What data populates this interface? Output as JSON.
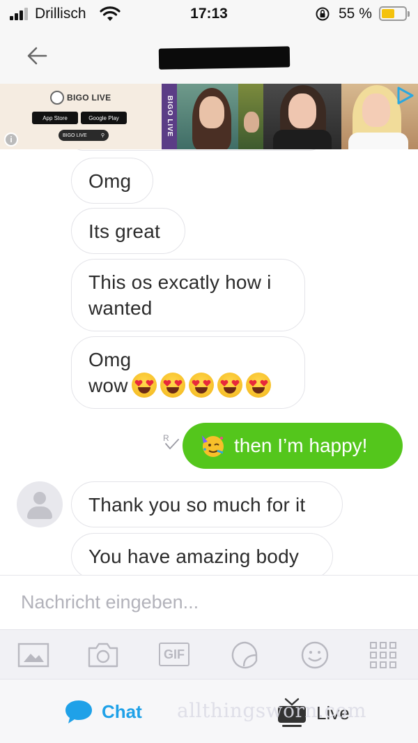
{
  "status_bar": {
    "carrier": "Drillisch",
    "time": "17:13",
    "battery_percent": "55 %",
    "battery_level": 0.55,
    "icons": [
      "signal-icon",
      "wifi-icon",
      "rotation-lock-icon",
      "battery-icon"
    ]
  },
  "header": {
    "back_icon": "arrow-left-icon",
    "contact_name_redacted": true
  },
  "ad": {
    "brand": "BIGO LIVE",
    "vertical_label": "BIGO LIVE",
    "store_badges": [
      "App Store",
      "Google Play"
    ],
    "search_label": "BIGO LIVE",
    "info_icon": "i",
    "icons": [
      "info-icon",
      "ad-choices-icon"
    ]
  },
  "messages": [
    {
      "direction": "in",
      "text": "Omg"
    },
    {
      "direction": "in",
      "text": "Its great"
    },
    {
      "direction": "in",
      "line1": "This os excatly how i",
      "line2": "wanted"
    },
    {
      "direction": "in",
      "line1": "Omg",
      "line2": "wow",
      "emoji": "heart-eyes-emoji",
      "emoji_count": 5
    },
    {
      "direction": "out",
      "emoji": "partying-face-emoji",
      "text": "then I’m happy!",
      "status_icon": "read-receipt-icon"
    },
    {
      "direction": "in",
      "text": "Thank you so much for it"
    },
    {
      "direction": "in",
      "text": "You have amazing body"
    }
  ],
  "composer": {
    "placeholder": "Nachricht eingeben...",
    "value": ""
  },
  "toolbar": {
    "gif_label": "GIF",
    "items": [
      "image-icon",
      "camera-icon",
      "gif-icon",
      "sticker-icon",
      "emoji-icon",
      "apps-grid-icon"
    ]
  },
  "tabs": {
    "chat_label": "Chat",
    "live_label": "Live",
    "active": "Chat"
  },
  "watermark": "allthingsworn.com",
  "colors": {
    "sent_bubble": "#54c61c",
    "accent": "#1fa1e8",
    "battery": "#f4c20d",
    "ad_vertical": "#5b3d86"
  }
}
